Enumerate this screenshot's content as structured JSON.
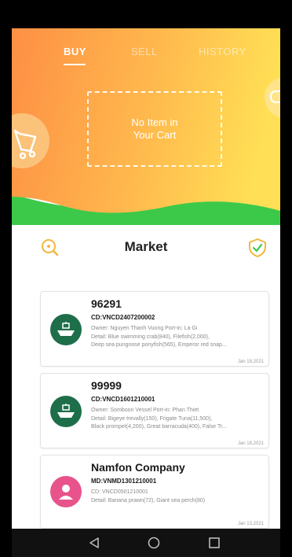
{
  "tabs": [
    {
      "label": "BUY",
      "active": true
    },
    {
      "label": "SELL",
      "active": false
    },
    {
      "label": "HISTORY",
      "active": false
    }
  ],
  "cart": {
    "empty_text": "No Item in Your Cart"
  },
  "market": {
    "title": "Market",
    "left_icon": "search-icon",
    "right_icon": "verified-shield-icon"
  },
  "listings": [
    {
      "title": "96291",
      "code": "CD:VNCD2407200002",
      "owner_line": "Owner: Nguyen Thanh Vuong  Port-in: La Gi",
      "detail_line1": "Detail: Blue swimming crab(840), Filefish(2,000),",
      "detail_line2": "Deep sea pungnose ponyfish(565), Emperor red snap...",
      "date": "Jan 18,2021",
      "avatar": "vessel-icon",
      "avatar_color": "#1e6e4a"
    },
    {
      "title": "99999",
      "code": "CD:VNCD1601210001",
      "owner_line": "Owner: Somboon Vessel  Port-in: Phan Thiet",
      "detail_line1": "Detail: Bigeye trevally(150), Frigate Tuna(11,500),",
      "detail_line2": "Black prompet(4,200), Great barracuda(400), False Tr...",
      "date": "Jan 18,2021",
      "avatar": "vessel-icon",
      "avatar_color": "#1e6e4a"
    },
    {
      "title": "Namfon Company",
      "code": "MD:VNMD1301210001",
      "owner_line": "CD: VNCD0501210001",
      "detail_line1": "Detail: Banana prawn(72), Giant sea perch(80)",
      "detail_line2": "",
      "date": "Jan 13,2021",
      "avatar": "person-icon",
      "avatar_color": "#e8538c"
    }
  ],
  "navbar": {
    "back_icon": "back-triangle-icon",
    "home_icon": "home-circle-icon",
    "recents_icon": "recents-square-icon"
  },
  "colors": {
    "hero_left": "#fe8f45",
    "hero_right": "#ffde55",
    "green_wave": "#3cc94a",
    "accent_icon": "#f2b73a"
  }
}
